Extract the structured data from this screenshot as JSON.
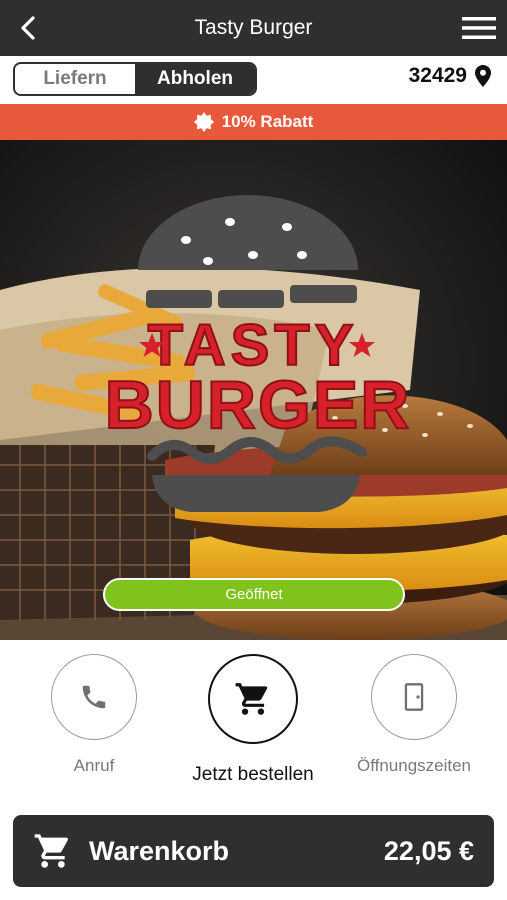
{
  "header": {
    "title": "Tasty Burger"
  },
  "order_mode": {
    "options": [
      "Liefern",
      "Abholen"
    ],
    "selected": "Abholen"
  },
  "location": {
    "zip": "32429"
  },
  "promo": {
    "text": "10% Rabatt"
  },
  "hero": {
    "logo_line1": "TASTY",
    "logo_line2": "BURGER",
    "status": "Geöffnet",
    "status_color": "#7fc31c"
  },
  "actions": [
    {
      "label": "Anruf",
      "icon": "phone-icon"
    },
    {
      "label": "Jetzt bestellen",
      "icon": "cart-icon"
    },
    {
      "label": "Öffnungszeiten",
      "icon": "door-icon"
    }
  ],
  "cart": {
    "label": "Warenkorb",
    "total": "22,05 €"
  },
  "colors": {
    "dark": "#2f2f2f",
    "accent": "#e8583a",
    "open": "#7fc31c",
    "logo_red": "#d6202a"
  }
}
